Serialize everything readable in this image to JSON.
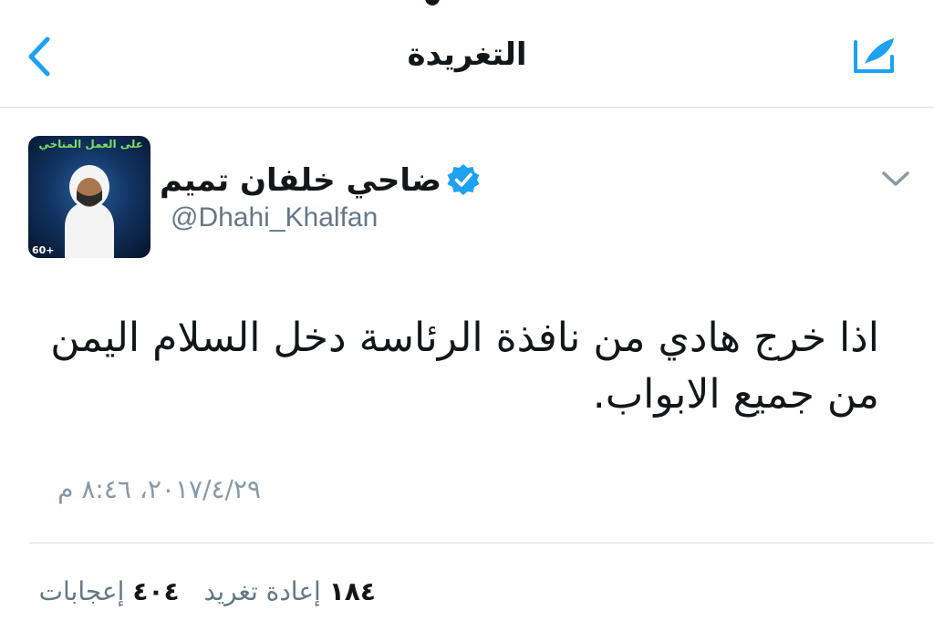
{
  "nav": {
    "title": "التغريدة"
  },
  "tweet": {
    "author": {
      "display_name": "ضاحي خلفان تميم",
      "handle": "@Dhahi_Khalfan",
      "verified": true,
      "avatar_banner_text": "على العمل المناخي",
      "avatar_badge_text": "60+"
    },
    "text": "اذا خرج هادي من نافذة الرئاسة دخل السلام اليمن من جميع الابواب.",
    "timestamp": "٢٠١٧/٤/٢٩، ٨:٤٦ م",
    "stats": {
      "retweets_count": "١٨٤",
      "retweets_label": "إعادة تغريد",
      "likes_count": "٤٠٤",
      "likes_label": "إعجابات"
    }
  },
  "colors": {
    "accent": "#1da1f2",
    "muted": "#8899a6",
    "divider": "#d8dde1"
  },
  "icons": [
    "back-chevron-icon",
    "compose-tweet-icon",
    "verified-badge-icon",
    "chevron-down-icon"
  ]
}
